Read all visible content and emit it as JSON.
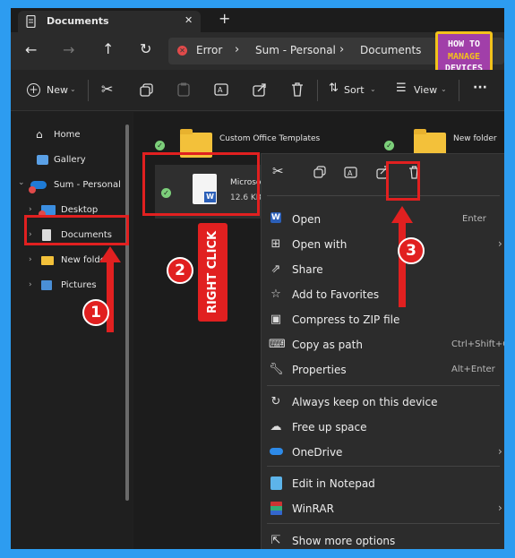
{
  "window": {
    "tab_title": "Documents",
    "tab_close": "✕",
    "new_tab": "+"
  },
  "nav_buttons": {
    "back": "←",
    "forward": "→",
    "up": "↑",
    "refresh": "↻"
  },
  "breadcrumb": {
    "items": [
      "Error",
      "Sum - Personal",
      "Documents"
    ],
    "separator": "›"
  },
  "logo": {
    "line1": "HOW TO",
    "line2": "MANAGE",
    "line3": "DEVICES"
  },
  "toolbar": {
    "new_label": "New",
    "sort_label": "Sort",
    "view_label": "View",
    "more": "···"
  },
  "sidebar": {
    "items": [
      {
        "label": "Home",
        "icon": "home-icon"
      },
      {
        "label": "Gallery",
        "icon": "gallery-icon"
      },
      {
        "label": "Sum - Personal",
        "icon": "onedrive-icon"
      },
      {
        "label": "Desktop",
        "icon": "desktop-icon"
      },
      {
        "label": "Documents",
        "icon": "documents-icon"
      },
      {
        "label": "New folde",
        "icon": "folder-icon"
      },
      {
        "label": "Pictures",
        "icon": "pictures-icon"
      }
    ]
  },
  "files": {
    "items": [
      {
        "name": "Custom Office Templates",
        "type": "folder"
      },
      {
        "name": "New folder",
        "type": "folder"
      },
      {
        "name": "Microsof",
        "size": "12.6 KB",
        "type": "word-document"
      }
    ]
  },
  "context_menu": {
    "items": [
      {
        "label": "Open",
        "shortcut": "Enter",
        "icon": "word-icon"
      },
      {
        "label": "Open with",
        "shortcut": "›",
        "icon": "open-with-icon"
      },
      {
        "label": "Share",
        "shortcut": "",
        "icon": "share-icon"
      },
      {
        "label": "Add to Favorites",
        "shortcut": "",
        "icon": "star-icon"
      },
      {
        "label": "Compress to ZIP file",
        "shortcut": "",
        "icon": "zip-icon"
      },
      {
        "label": "Copy as path",
        "shortcut": "Ctrl+Shift+C",
        "icon": "copy-path-icon"
      },
      {
        "label": "Properties",
        "shortcut": "Alt+Enter",
        "icon": "properties-icon"
      },
      {
        "label": "Always keep on this device",
        "shortcut": "",
        "icon": "sync-icon"
      },
      {
        "label": "Free up space",
        "shortcut": "",
        "icon": "cloud-icon"
      },
      {
        "label": "OneDrive",
        "shortcut": "›",
        "icon": "onedrive-icon"
      },
      {
        "label": "Edit in Notepad",
        "shortcut": "",
        "icon": "notepad-icon"
      },
      {
        "label": "WinRAR",
        "shortcut": "›",
        "icon": "winrar-icon"
      },
      {
        "label": "Show more options",
        "shortcut": "",
        "icon": "more-options-icon"
      }
    ]
  },
  "annotations": {
    "step1": "1",
    "step2": "2",
    "step3": "3",
    "right_click_label": "RIGHT CLICK"
  },
  "colors": {
    "accent": "#e12020",
    "frame": "#2d9cf0",
    "folder": "#f3c13a"
  }
}
